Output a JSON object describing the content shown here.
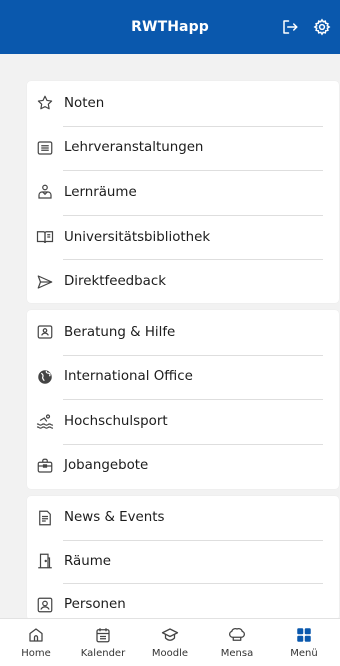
{
  "header": {
    "title": "RWTHapp",
    "logout_icon": "logout-icon",
    "settings_icon": "gear-icon"
  },
  "colors": {
    "brand": "#0a58ad",
    "background": "#f2f2f2",
    "card": "#ffffff"
  },
  "groups": [
    {
      "items": [
        {
          "label": "Noten",
          "icon": "star-icon"
        },
        {
          "label": "Lehrveranstaltungen",
          "icon": "list-icon"
        },
        {
          "label": "Lernräume",
          "icon": "desk-lamp-icon"
        },
        {
          "label": "Universitätsbibliothek",
          "icon": "book-icon"
        },
        {
          "label": "Direktfeedback",
          "icon": "send-icon"
        }
      ]
    },
    {
      "items": [
        {
          "label": "Beratung & Hilfe",
          "icon": "id-card-icon"
        },
        {
          "label": "International Office",
          "icon": "globe-icon"
        },
        {
          "label": "Hochschulsport",
          "icon": "swimming-icon"
        },
        {
          "label": "Jobangebote",
          "icon": "briefcase-icon"
        }
      ]
    },
    {
      "items": [
        {
          "label": "News & Events",
          "icon": "newspaper-icon"
        },
        {
          "label": "Räume",
          "icon": "door-icon"
        },
        {
          "label": "Personen",
          "icon": "person-icon"
        }
      ]
    }
  ],
  "bottom_nav": [
    {
      "label": "Home",
      "icon": "home-icon",
      "active": false
    },
    {
      "label": "Kalender",
      "icon": "calendar-icon",
      "active": false
    },
    {
      "label": "Moodle",
      "icon": "mortarboard-icon",
      "active": false
    },
    {
      "label": "Mensa",
      "icon": "chef-hat-icon",
      "active": false
    },
    {
      "label": "Menü",
      "icon": "grid-icon",
      "active": true
    }
  ]
}
